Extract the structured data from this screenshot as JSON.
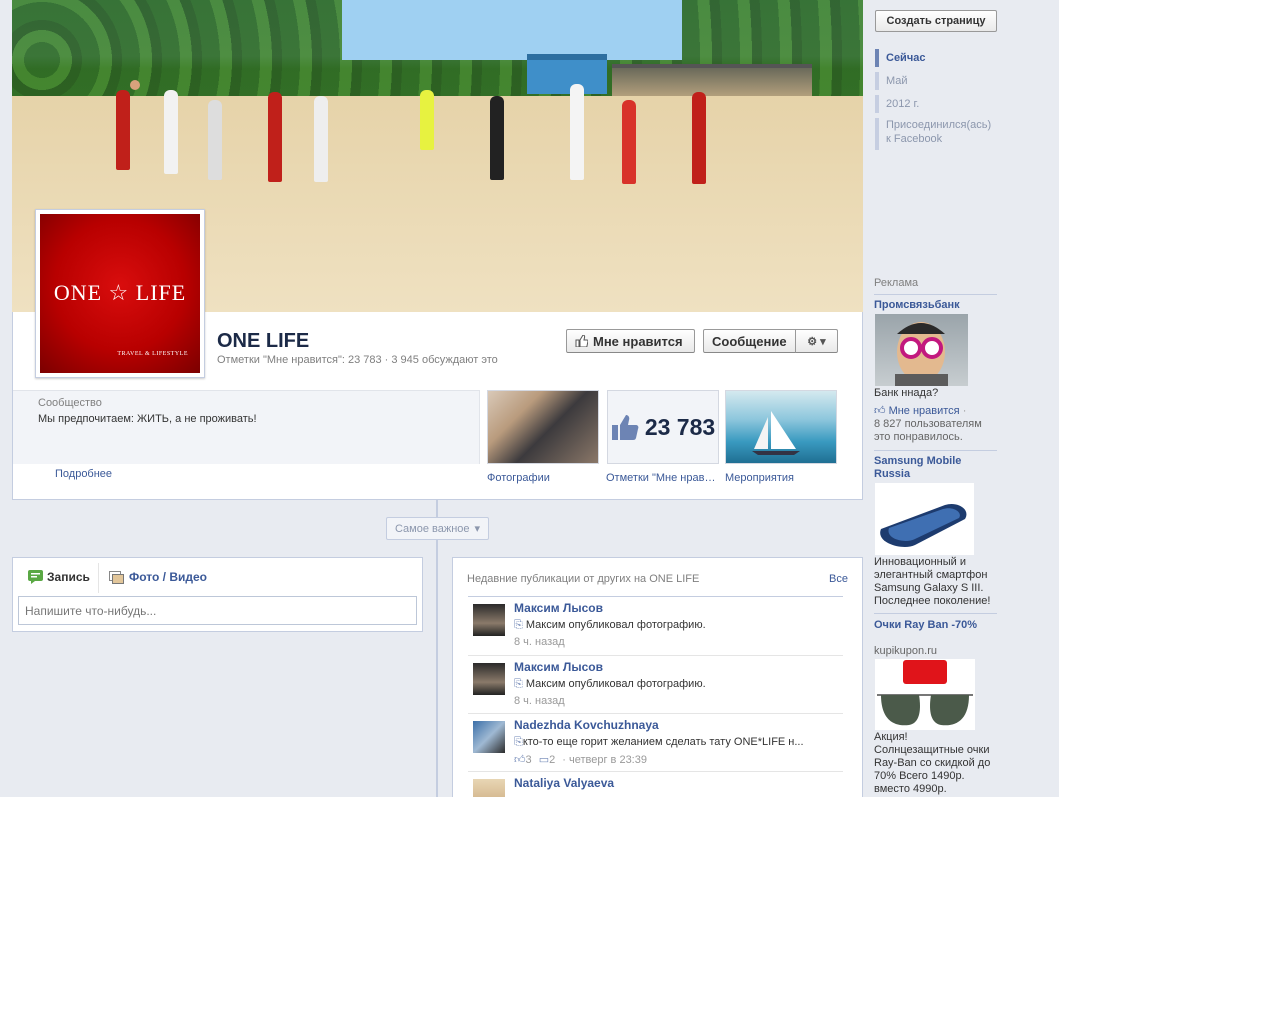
{
  "page": {
    "name": "ONE LIFE",
    "stats": "Отметки \"Мне нравится\": 23 783 · 3 945 обсуждают это",
    "avatar_logo": "ONE ☆ LIFE",
    "avatar_sub": "TRAVEL & LIFESTYLE"
  },
  "actions": {
    "like": "Мне нравится",
    "message": "Сообщение",
    "gear": "⚙ ▾"
  },
  "about": {
    "label": "Сообщество",
    "text": "Мы предпочитаем: ЖИТЬ, а не проживать!",
    "more": "Подробнее"
  },
  "tiles": [
    {
      "label": "Фотографии"
    },
    {
      "label": "Отметки \"Мне нравится\"",
      "count": "23 783"
    },
    {
      "label": "Мероприятия"
    }
  ],
  "timeline": {
    "sort": "Самое важное"
  },
  "composer": {
    "tab_post": "Запись",
    "tab_photo": "Фото / Видео",
    "placeholder": "Напишите что-нибудь..."
  },
  "recent": {
    "title": "Недавние публикации от других на ONE LIFE",
    "all": "Все",
    "posts": [
      {
        "name": "Максим Лысов",
        "text": "Максим опубликовал фотографию.",
        "time": "8 ч. назад"
      },
      {
        "name": "Максим Лысов",
        "text": "Максим опубликовал фотографию.",
        "time": "8 ч. назад"
      },
      {
        "name": "Nadezhda Kovchuzhnaya",
        "text": "кто-то еще горит желанием сделать тату ONE*LIFE н...",
        "likes": "3",
        "comments": "2",
        "time": "· четверг в 23:39"
      },
      {
        "name": "Nataliya Valyaeva",
        "text": "",
        "time": ""
      }
    ]
  },
  "sidebar": {
    "create_page": "Создать страницу",
    "nav": [
      "Сейчас",
      "Май",
      "2012 г.",
      "Присоединился(ась) к Facebook"
    ]
  },
  "ads": {
    "label": "Реклама",
    "items": [
      {
        "title": "Промсвязьбанк",
        "text": "Банк ннада?",
        "like": "Мне нравится",
        "social": "8 827 пользователям это понравилось."
      },
      {
        "title": "Samsung Mobile Russia",
        "text": "Инновационный и элегантный смартфон Samsung Galaxy S III. Последнее поколение!"
      },
      {
        "title": "Очки Ray Ban -70%",
        "domain": "kupikupon.ru",
        "text": "Акция! Солнцезащитные очки Ray-Ban со скидкой до 70% Всего 1490р. вместо 4990р."
      }
    ]
  },
  "colors": {
    "link": "#3b5998",
    "background": "#e8ebf1",
    "border": "#c4cde0"
  }
}
